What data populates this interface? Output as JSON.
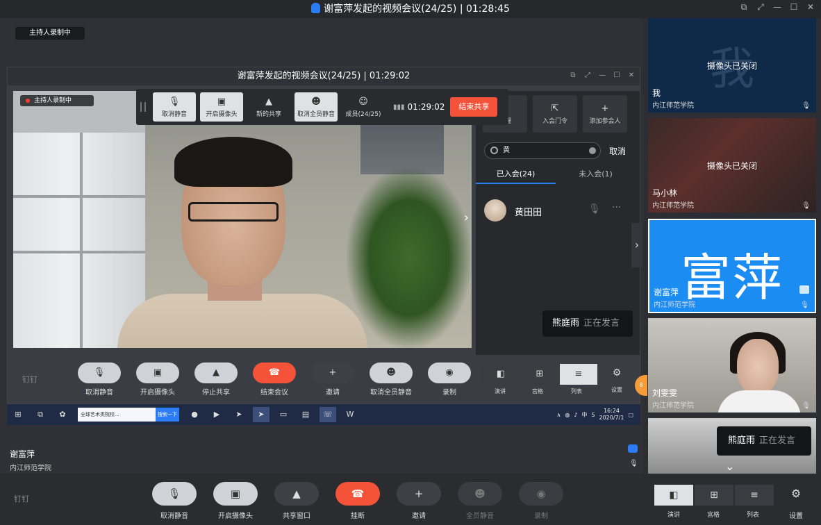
{
  "titlebar": {
    "title": "谢富萍发起的视频会议(24/25)  |  01:28:45"
  },
  "rec_badge": "主持人录制中",
  "inner": {
    "title": "谢富萍发起的视频会议(24/25)  |  01:29:02",
    "video_rec": "主持人录制中",
    "floatbar": {
      "unmute": "取消静音",
      "camera": "开启摄像头",
      "new_share": "新的共享",
      "unmute_all": "取消全员静音",
      "members": "成员(24/25)",
      "time": "01:29:02",
      "end_share": "结束共享"
    },
    "panel": {
      "btn_manage": "管理",
      "btn_door": "入会门令",
      "btn_add": "添加参会人",
      "search_value": "黄",
      "cancel": "取消",
      "tab_joined": "已入会(24)",
      "tab_notjoined": "未入会(1)",
      "member_name": "黄田田"
    },
    "speaking": {
      "name": "熊庭雨",
      "status": "正在发言"
    },
    "toolbar": {
      "dingding": "钉钉",
      "unmute": "取消静音",
      "camera": "开启摄像头",
      "stop_share": "停止共享",
      "end_meeting": "结束会议",
      "invite": "邀请",
      "unmute_all": "取消全员静音",
      "record": "录制",
      "lay_speech": "演讲",
      "lay_grid": "宫格",
      "lay_list": "列表",
      "settings": "设置",
      "badge": "8"
    },
    "taskbar": {
      "ie_text": "全球艺术类院校...",
      "search_btn": "搜索一下",
      "ime": "中",
      "time": "16:24",
      "date": "2020/7/1"
    }
  },
  "owner": {
    "name": "谢富萍",
    "org": "内江师范学院"
  },
  "thumbs": [
    {
      "big": "我",
      "caption": "摄像头已关闭",
      "name": "我",
      "org": "内江师范学院"
    },
    {
      "caption": "摄像头已关闭",
      "name": "马小林",
      "org": "内江师范学院"
    },
    {
      "big": "富萍",
      "name": "谢富萍",
      "org": "内江师范学院"
    },
    {
      "name": "刘雯雯",
      "org": "内江师范学院"
    }
  ],
  "speaking2": {
    "name": "熊庭雨",
    "status": "正在发言"
  },
  "mainbar": {
    "dingding": "钉钉",
    "unmute": "取消静音",
    "camera": "开启摄像头",
    "share_window": "共享窗口",
    "hangup": "挂断",
    "invite": "邀请",
    "mute_all": "全员静音",
    "record": "录制",
    "lay_speech": "演讲",
    "lay_grid": "宫格",
    "lay_list": "列表",
    "settings": "设置"
  },
  "colors": {
    "accent": "#2b7cf5",
    "danger": "#f4533a",
    "bg": "#2c2e33"
  }
}
